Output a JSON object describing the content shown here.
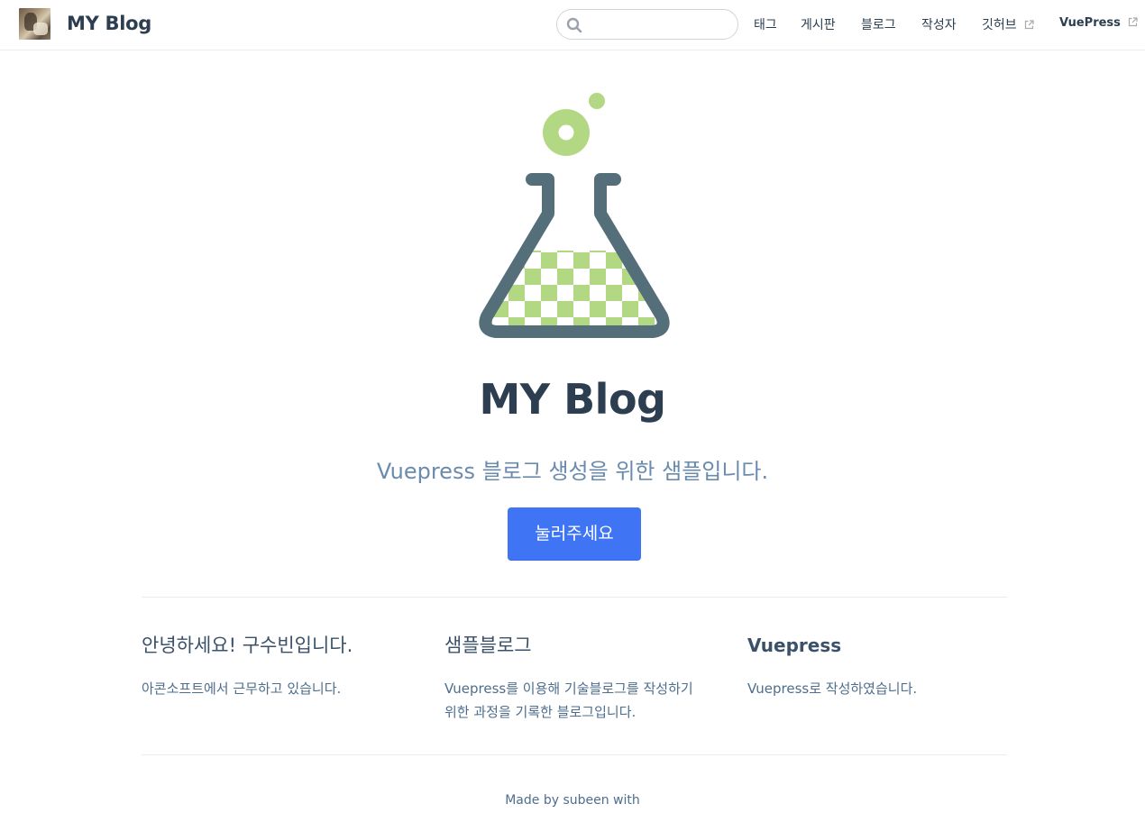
{
  "navbar": {
    "site_name": "MY Blog",
    "search": {
      "placeholder": "",
      "value": ""
    },
    "items": [
      {
        "label": "태그"
      },
      {
        "label": "게시판"
      },
      {
        "label": "블로그"
      },
      {
        "label": "작성자"
      },
      {
        "label": "깃허브",
        "external": true
      },
      {
        "label": "VuePress",
        "external": true
      }
    ]
  },
  "hero": {
    "title": "MY Blog",
    "description": "Vuepress 블로그 생성을 위한 샘플입니다.",
    "action_label": "눌러주세요",
    "logo_colors": {
      "flask": "#546e7a",
      "liquid": "#b2d883"
    }
  },
  "features": [
    {
      "title": "안녕하세요! 구수빈입니다.",
      "details": "아콘소프트에서 근무하고 있습니다."
    },
    {
      "title": "샘플블로그",
      "details": "Vuepress를 이용해 기술블로그를 작성하기 위한 과정을 기록한 블로그입니다."
    },
    {
      "title": "Vuepress",
      "details": "Vuepress로 작성하였습니다."
    }
  ],
  "footer": {
    "text": "Made by subeen with"
  },
  "colors": {
    "accent": "#3f74f5",
    "text": "#2c3e50",
    "muted": "#6a8bad"
  }
}
